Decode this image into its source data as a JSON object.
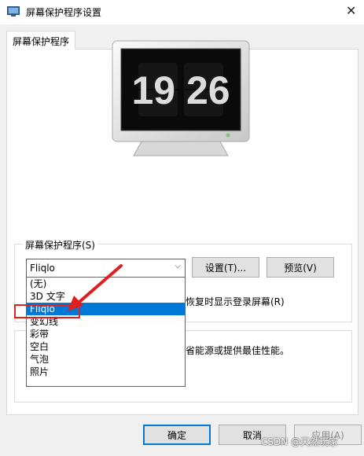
{
  "window": {
    "title": "屏幕保护程序设置",
    "close_glyph": "✕"
  },
  "tab": {
    "label": "屏幕保护程序"
  },
  "preview": {
    "clock_text": "19 26"
  },
  "screensaver_group": {
    "label": "屏幕保护程序(S)",
    "selected_value": "Fliqlo",
    "settings_button": "设置(T)...",
    "preview_button": "预览(V)",
    "resume_text": "恢复时显示登录屏幕(R)"
  },
  "dropdown": {
    "options": [
      "(无)",
      "3D 文字",
      "Fliqlo",
      "变幻线",
      "彩带",
      "空白",
      "气泡",
      "照片"
    ],
    "selected_index": 2
  },
  "power_group": {
    "text": "省能源或提供最佳性能。"
  },
  "footer": {
    "ok": "确定",
    "cancel": "取消",
    "apply": "应用(A)"
  },
  "watermark": "CSDN @天然玩家",
  "colors": {
    "accent": "#0078d7",
    "annotation": "#e02020"
  },
  "icons": {
    "app": "screensaver-monitor-icon",
    "close": "close-icon",
    "combo": "chevron-down-icon"
  }
}
